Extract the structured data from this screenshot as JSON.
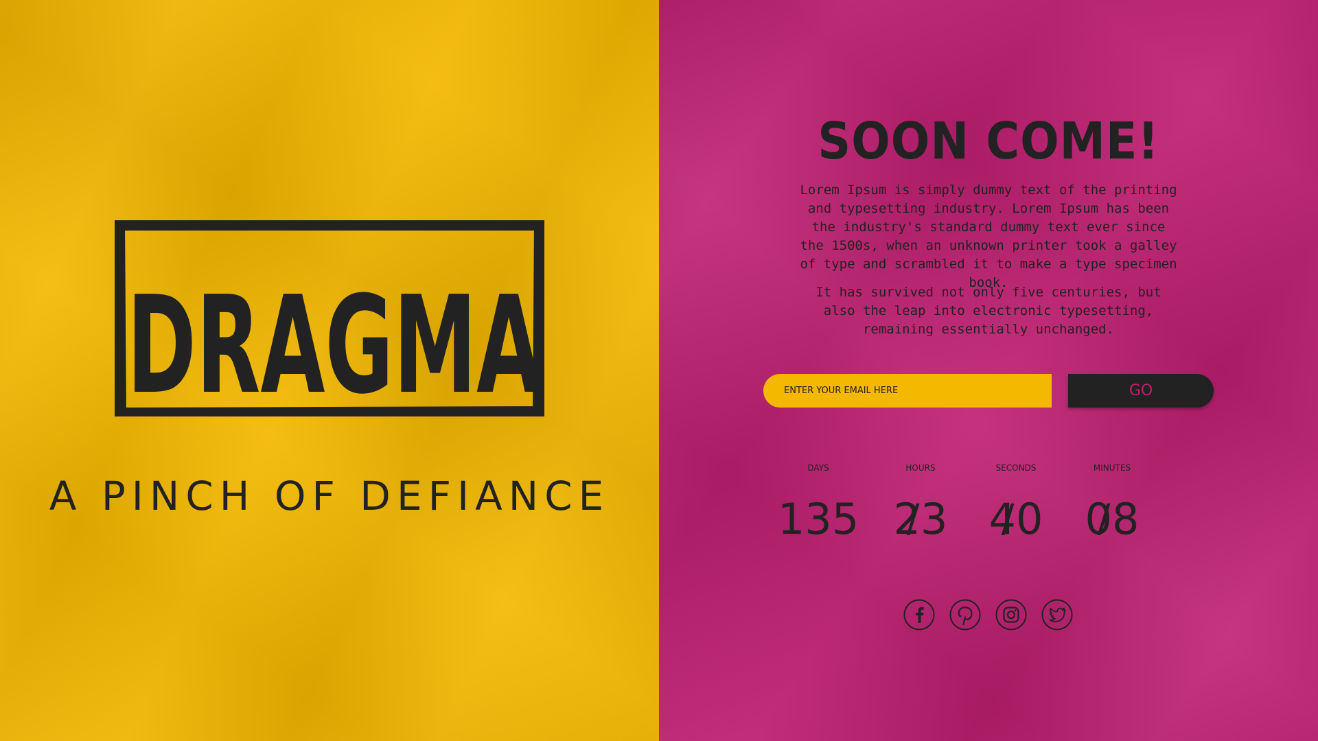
{
  "brand": {
    "logo_text": "DRAGMA",
    "tagline": "A PINCH OF DEFIANCE"
  },
  "colors": {
    "left_background": "#f4b800",
    "right_background": "#bf1f72",
    "ink": "#222222"
  },
  "hero": {
    "heading": "SOON COME!",
    "paragraph_1": "Lorem Ipsum is simply dummy text of the printing and typesetting industry. Lorem Ipsum has been the industry's standard dummy text ever since the 1500s, when an unknown printer took a galley of type and scrambled it to make a type specimen book.",
    "paragraph_2": "It has survived not only five centuries, but also the leap into electronic typesetting, remaining essentially unchanged."
  },
  "subscribe": {
    "email_placeholder": "ENTER YOUR EMAIL HERE",
    "go_label": "GO"
  },
  "countdown": {
    "separator": "/",
    "units": [
      {
        "label": "DAYS",
        "value": "135"
      },
      {
        "label": "HOURS",
        "value": "23"
      },
      {
        "label": "SECONDS",
        "value": "40"
      },
      {
        "label": "MINUTES",
        "value": "08"
      }
    ]
  },
  "social": {
    "icons": [
      "facebook-icon",
      "pinterest-icon",
      "instagram-icon",
      "twitter-icon"
    ]
  }
}
